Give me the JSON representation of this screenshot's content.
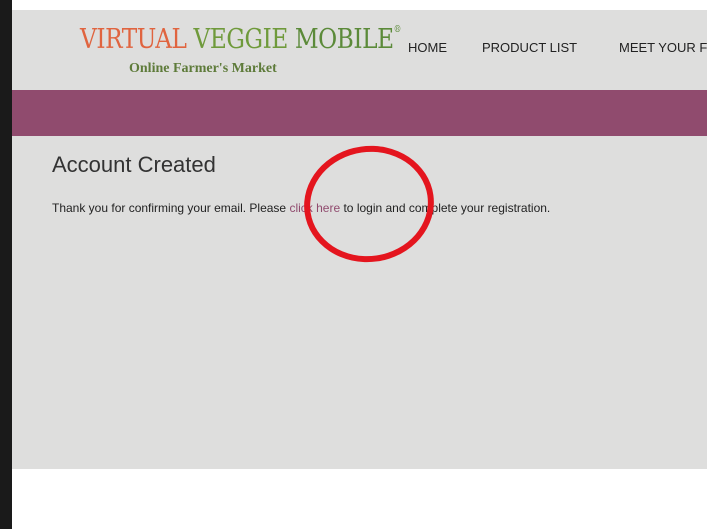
{
  "header": {
    "logo": {
      "title_virtual": "VIRTUAL",
      "title_veggie": "VEGGIE",
      "title_mobile": "MOBILE",
      "registered_mark": "®",
      "subtitle": "Online Farmer's Market"
    },
    "nav": {
      "home": "HOME",
      "product_list": "PRODUCT LIST",
      "meet_your": "MEET YOUR F"
    }
  },
  "main": {
    "title": "Account Created",
    "message_before": "Thank you for confirming your email. Please ",
    "link_text": "click here",
    "message_after": " to login and complete your registration."
  },
  "colors": {
    "accent_band": "#904b6e",
    "link": "#904b6e",
    "annotation_circle": "#e4151e",
    "logo_orange": "#e0643f",
    "logo_green": "#6f9a3b"
  }
}
